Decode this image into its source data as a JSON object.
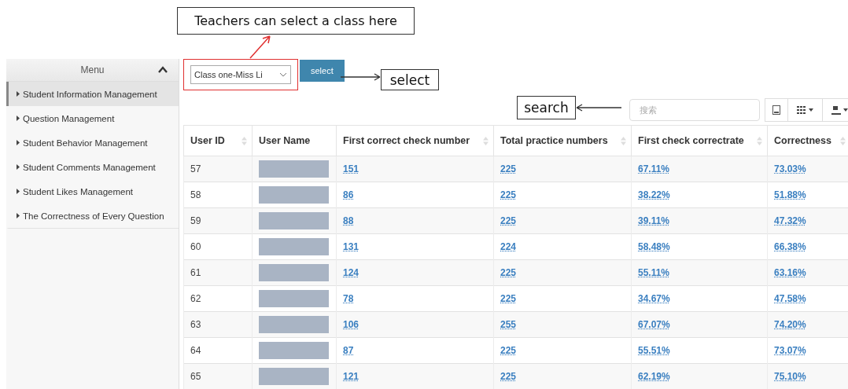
{
  "callouts": {
    "class_hint": "Teachers can select a class here",
    "select_hint": "select",
    "search_hint": "search"
  },
  "sidebar": {
    "title": "Menu",
    "expanded": true,
    "items": [
      {
        "label": "Student Information Management",
        "selected": true
      },
      {
        "label": "Question Management",
        "selected": false
      },
      {
        "label": "Student Behavior Management",
        "selected": false
      },
      {
        "label": "Student Comments Management",
        "selected": false
      },
      {
        "label": "Student Likes Management",
        "selected": false
      },
      {
        "label": "The Correctness of Every Question",
        "selected": false
      }
    ]
  },
  "class_select": {
    "value": "Class one-Miss Li"
  },
  "select_button": "select",
  "search": {
    "placeholder": "搜索"
  },
  "table": {
    "columns": [
      {
        "label": "User ID",
        "sortable": true
      },
      {
        "label": "User Name",
        "sortable": false
      },
      {
        "label": "First correct check number",
        "sortable": true
      },
      {
        "label": "Total practice numbers",
        "sortable": true
      },
      {
        "label": "First check correctrate",
        "sortable": true
      },
      {
        "label": "Correctness",
        "sortable": true
      }
    ],
    "rows": [
      {
        "user_id": "57",
        "name_hidden": true,
        "first_correct": "151",
        "total": "225",
        "first_rate": "67.11%",
        "correctness": "73.03%"
      },
      {
        "user_id": "58",
        "name_hidden": true,
        "first_correct": "86",
        "total": "225",
        "first_rate": "38.22%",
        "correctness": "51.88%"
      },
      {
        "user_id": "59",
        "name_hidden": true,
        "first_correct": "88",
        "total": "225",
        "first_rate": "39.11%",
        "correctness": "47.32%"
      },
      {
        "user_id": "60",
        "name_hidden": true,
        "first_correct": "131",
        "total": "224",
        "first_rate": "58.48%",
        "correctness": "66.38%"
      },
      {
        "user_id": "61",
        "name_hidden": true,
        "first_correct": "124",
        "total": "225",
        "first_rate": "55.11%",
        "correctness": "63.16%"
      },
      {
        "user_id": "62",
        "name_hidden": true,
        "first_correct": "78",
        "total": "225",
        "first_rate": "34.67%",
        "correctness": "47.58%"
      },
      {
        "user_id": "63",
        "name_hidden": true,
        "first_correct": "106",
        "total": "255",
        "first_rate": "67.07%",
        "correctness": "74.20%"
      },
      {
        "user_id": "64",
        "name_hidden": true,
        "first_correct": "87",
        "total": "225",
        "first_rate": "55.51%",
        "correctness": "73.07%"
      },
      {
        "user_id": "65",
        "name_hidden": true,
        "first_correct": "121",
        "total": "225",
        "first_rate": "62.19%",
        "correctness": "75.10%"
      }
    ]
  }
}
